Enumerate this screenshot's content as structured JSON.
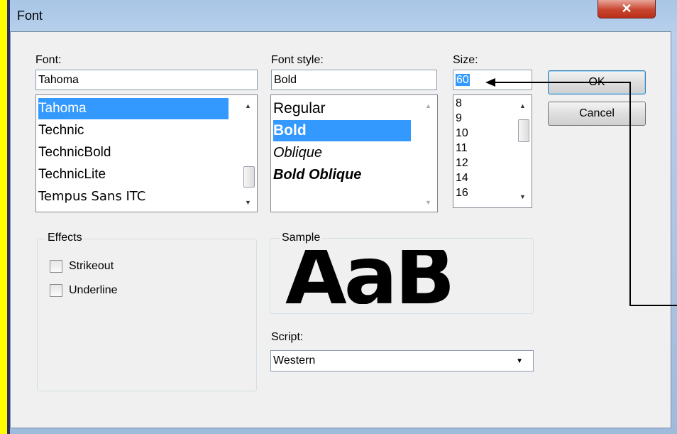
{
  "window": {
    "title": "Font",
    "close_glyph": "✕"
  },
  "font": {
    "label": "Font:",
    "value": "Tahoma",
    "items": [
      "Tahoma",
      "Technic",
      "TechnicBold",
      "TechnicLite",
      "Tempus Sans ITC"
    ],
    "selected": "Tahoma"
  },
  "font_style": {
    "label": "Font style:",
    "value": "Bold",
    "items": [
      "Regular",
      "Bold",
      "Oblique",
      "Bold Oblique"
    ],
    "selected": "Bold"
  },
  "size": {
    "label": "Size:",
    "value": "60",
    "items": [
      "8",
      "9",
      "10",
      "11",
      "12",
      "14",
      "16"
    ]
  },
  "buttons": {
    "ok": "OK",
    "cancel": "Cancel"
  },
  "effects": {
    "label": "Effects",
    "strikeout": "Strikeout",
    "underline": "Underline",
    "strikeout_checked": false,
    "underline_checked": false
  },
  "sample": {
    "label": "Sample",
    "text": "AaB"
  },
  "script": {
    "label": "Script:",
    "value": "Western"
  },
  "colors": {
    "selection": "#3399ff",
    "annotation_arrow": "#000000"
  }
}
